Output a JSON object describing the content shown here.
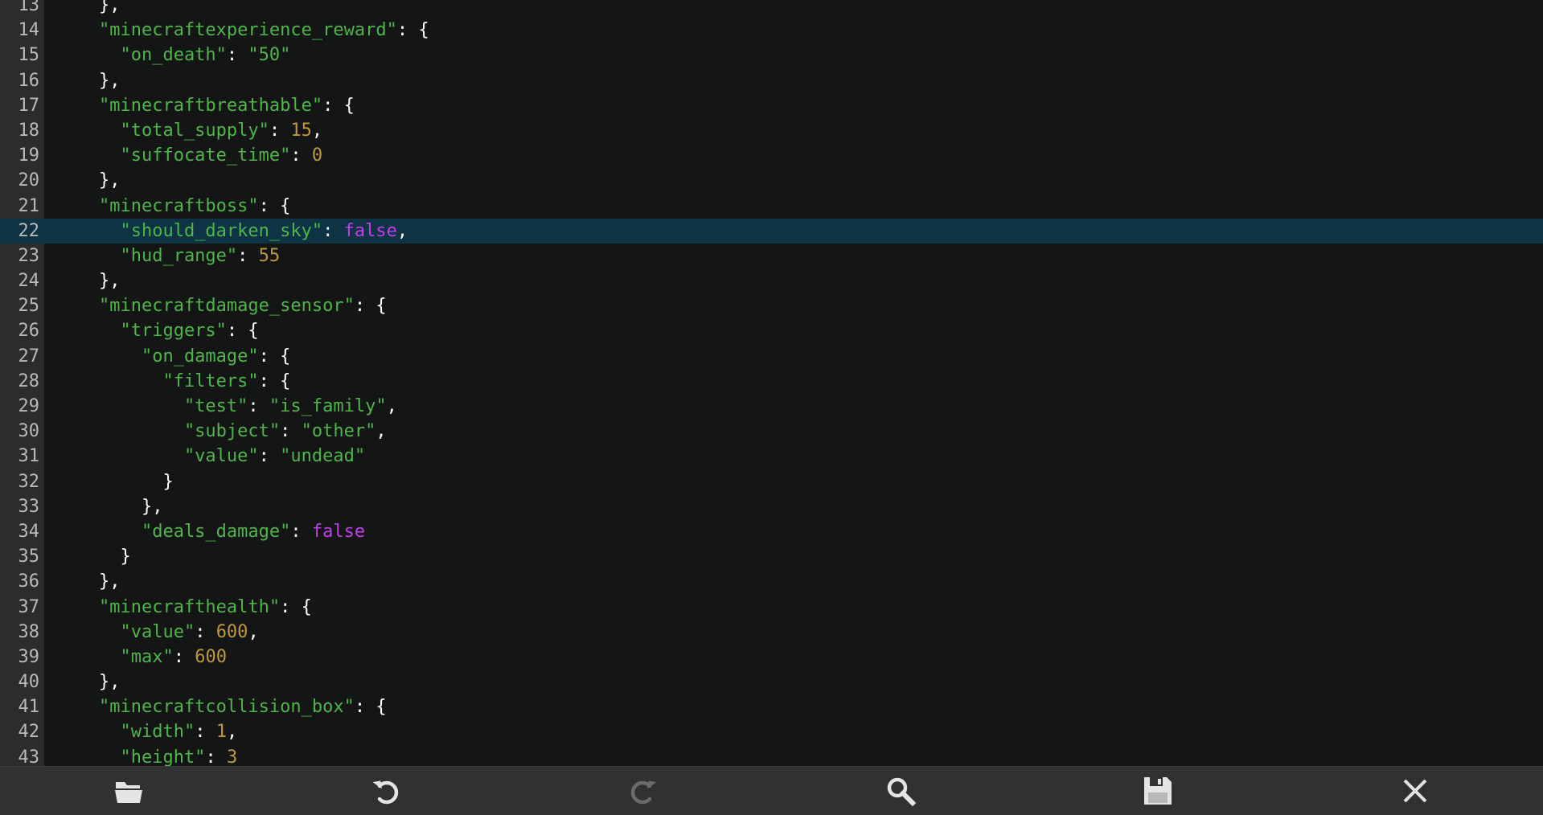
{
  "editor": {
    "highlighted_line": 22,
    "lines": [
      {
        "n": "13",
        "tokens": [
          {
            "t": "    },",
            "c": "t-punc"
          }
        ]
      },
      {
        "n": "14",
        "tokens": [
          {
            "t": "    \"minecraftexperience_reward\"",
            "c": "t-key"
          },
          {
            "t": ": {",
            "c": "t-punc"
          }
        ]
      },
      {
        "n": "15",
        "tokens": [
          {
            "t": "      \"on_death\"",
            "c": "t-key"
          },
          {
            "t": ": ",
            "c": "t-punc"
          },
          {
            "t": "\"50\"",
            "c": "t-str"
          }
        ]
      },
      {
        "n": "16",
        "tokens": [
          {
            "t": "    },",
            "c": "t-punc"
          }
        ]
      },
      {
        "n": "17",
        "tokens": [
          {
            "t": "    \"minecraftbreathable\"",
            "c": "t-key"
          },
          {
            "t": ": {",
            "c": "t-punc"
          }
        ]
      },
      {
        "n": "18",
        "tokens": [
          {
            "t": "      \"total_supply\"",
            "c": "t-key"
          },
          {
            "t": ": ",
            "c": "t-punc"
          },
          {
            "t": "15",
            "c": "t-num"
          },
          {
            "t": ",",
            "c": "t-punc"
          }
        ]
      },
      {
        "n": "19",
        "tokens": [
          {
            "t": "      \"suffocate_time\"",
            "c": "t-key"
          },
          {
            "t": ": ",
            "c": "t-punc"
          },
          {
            "t": "0",
            "c": "t-num"
          }
        ]
      },
      {
        "n": "20",
        "tokens": [
          {
            "t": "    },",
            "c": "t-punc"
          }
        ]
      },
      {
        "n": "21",
        "tokens": [
          {
            "t": "    \"minecraftboss\"",
            "c": "t-key"
          },
          {
            "t": ": {",
            "c": "t-punc"
          }
        ]
      },
      {
        "n": "22",
        "tokens": [
          {
            "t": "      \"should_darken_sky\"",
            "c": "t-key"
          },
          {
            "t": ": ",
            "c": "t-punc"
          },
          {
            "t": "false",
            "c": "t-bool"
          },
          {
            "t": ",",
            "c": "t-punc"
          }
        ]
      },
      {
        "n": "23",
        "tokens": [
          {
            "t": "      \"hud_range\"",
            "c": "t-key"
          },
          {
            "t": ": ",
            "c": "t-punc"
          },
          {
            "t": "55",
            "c": "t-num"
          }
        ]
      },
      {
        "n": "24",
        "tokens": [
          {
            "t": "    },",
            "c": "t-punc"
          }
        ]
      },
      {
        "n": "25",
        "tokens": [
          {
            "t": "    \"minecraftdamage_sensor\"",
            "c": "t-key"
          },
          {
            "t": ": {",
            "c": "t-punc"
          }
        ]
      },
      {
        "n": "26",
        "tokens": [
          {
            "t": "      \"triggers\"",
            "c": "t-key"
          },
          {
            "t": ": {",
            "c": "t-punc"
          }
        ]
      },
      {
        "n": "27",
        "tokens": [
          {
            "t": "        \"on_damage\"",
            "c": "t-key"
          },
          {
            "t": ": {",
            "c": "t-punc"
          }
        ]
      },
      {
        "n": "28",
        "tokens": [
          {
            "t": "          \"filters\"",
            "c": "t-key"
          },
          {
            "t": ": {",
            "c": "t-punc"
          }
        ]
      },
      {
        "n": "29",
        "tokens": [
          {
            "t": "            \"test\"",
            "c": "t-key"
          },
          {
            "t": ": ",
            "c": "t-punc"
          },
          {
            "t": "\"is_family\"",
            "c": "t-str"
          },
          {
            "t": ",",
            "c": "t-punc"
          }
        ]
      },
      {
        "n": "30",
        "tokens": [
          {
            "t": "            \"subject\"",
            "c": "t-key"
          },
          {
            "t": ": ",
            "c": "t-punc"
          },
          {
            "t": "\"other\"",
            "c": "t-str"
          },
          {
            "t": ",",
            "c": "t-punc"
          }
        ]
      },
      {
        "n": "31",
        "tokens": [
          {
            "t": "            \"value\"",
            "c": "t-key"
          },
          {
            "t": ": ",
            "c": "t-punc"
          },
          {
            "t": "\"undead\"",
            "c": "t-str"
          }
        ]
      },
      {
        "n": "32",
        "tokens": [
          {
            "t": "          }",
            "c": "t-punc"
          }
        ]
      },
      {
        "n": "33",
        "tokens": [
          {
            "t": "        },",
            "c": "t-punc"
          }
        ]
      },
      {
        "n": "34",
        "tokens": [
          {
            "t": "        \"deals_damage\"",
            "c": "t-key"
          },
          {
            "t": ": ",
            "c": "t-punc"
          },
          {
            "t": "false",
            "c": "t-bool"
          }
        ]
      },
      {
        "n": "35",
        "tokens": [
          {
            "t": "      }",
            "c": "t-punc"
          }
        ]
      },
      {
        "n": "36",
        "tokens": [
          {
            "t": "    },",
            "c": "t-punc"
          }
        ]
      },
      {
        "n": "37",
        "tokens": [
          {
            "t": "    \"minecrafthealth\"",
            "c": "t-key"
          },
          {
            "t": ": {",
            "c": "t-punc"
          }
        ]
      },
      {
        "n": "38",
        "tokens": [
          {
            "t": "      \"value\"",
            "c": "t-key"
          },
          {
            "t": ": ",
            "c": "t-punc"
          },
          {
            "t": "600",
            "c": "t-num"
          },
          {
            "t": ",",
            "c": "t-punc"
          }
        ]
      },
      {
        "n": "39",
        "tokens": [
          {
            "t": "      \"max\"",
            "c": "t-key"
          },
          {
            "t": ": ",
            "c": "t-punc"
          },
          {
            "t": "600",
            "c": "t-num"
          }
        ]
      },
      {
        "n": "40",
        "tokens": [
          {
            "t": "    },",
            "c": "t-punc"
          }
        ]
      },
      {
        "n": "41",
        "tokens": [
          {
            "t": "    \"minecraftcollision_box\"",
            "c": "t-key"
          },
          {
            "t": ": {",
            "c": "t-punc"
          }
        ]
      },
      {
        "n": "42",
        "tokens": [
          {
            "t": "      \"width\"",
            "c": "t-key"
          },
          {
            "t": ": ",
            "c": "t-punc"
          },
          {
            "t": "1",
            "c": "t-num"
          },
          {
            "t": ",",
            "c": "t-punc"
          }
        ]
      },
      {
        "n": "43",
        "tokens": [
          {
            "t": "      \"height\"",
            "c": "t-key"
          },
          {
            "t": ": ",
            "c": "t-punc"
          },
          {
            "t": "3",
            "c": "t-num"
          }
        ]
      }
    ]
  },
  "toolbar": {
    "buttons": [
      {
        "name": "open-folder-button",
        "icon": "folder-icon"
      },
      {
        "name": "undo-button",
        "icon": "undo-icon"
      },
      {
        "name": "redo-button",
        "icon": "redo-icon"
      },
      {
        "name": "search-button",
        "icon": "search-icon"
      },
      {
        "name": "save-button",
        "icon": "save-icon"
      },
      {
        "name": "close-button",
        "icon": "close-icon"
      }
    ]
  },
  "colors": {
    "background": "#141615",
    "gutter": "#2b2c2b",
    "highlight": "#0d3344",
    "key": "#4fb449",
    "number": "#c0973e",
    "boolean": "#c43ee8",
    "toolbar": "#313131"
  }
}
